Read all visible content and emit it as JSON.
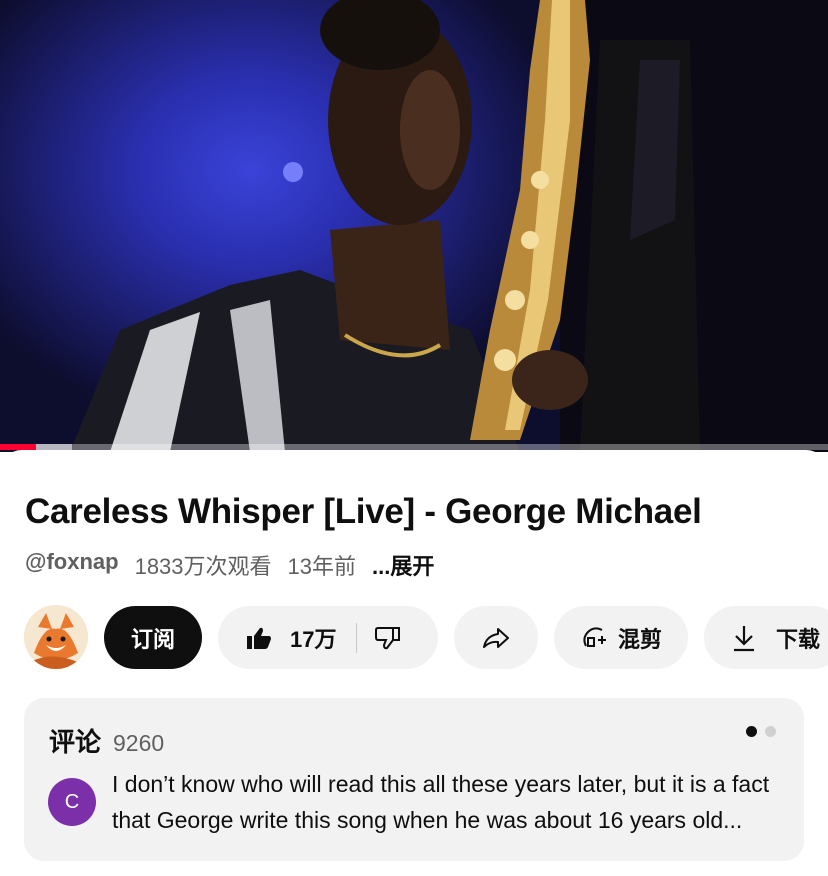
{
  "video": {
    "progress_played": 0.043,
    "progress_buffered": 0.087
  },
  "title": "Careless Whisper [Live] - George Michael",
  "meta": {
    "channel": "@foxnap",
    "views": "1833万次观看",
    "age": "13年前",
    "expand": "...展开"
  },
  "actions": {
    "subscribe": "订阅",
    "likes": "17万",
    "remix": "混剪",
    "download": "下载"
  },
  "comments": {
    "title": "评论",
    "count": "9260",
    "avatar_letter": "C",
    "first_comment": "I don’t know who will read this all these years later, but it is a fact that George write this song when he was about 16 years old..."
  },
  "icons": {
    "like": "thumbs-up-icon",
    "dislike": "thumbs-down-icon",
    "share": "share-arrow-icon",
    "remix": "remix-icon",
    "download": "download-icon"
  },
  "colors": {
    "progress": "#ff0033",
    "avatar_bg": "#7b2fa8"
  }
}
